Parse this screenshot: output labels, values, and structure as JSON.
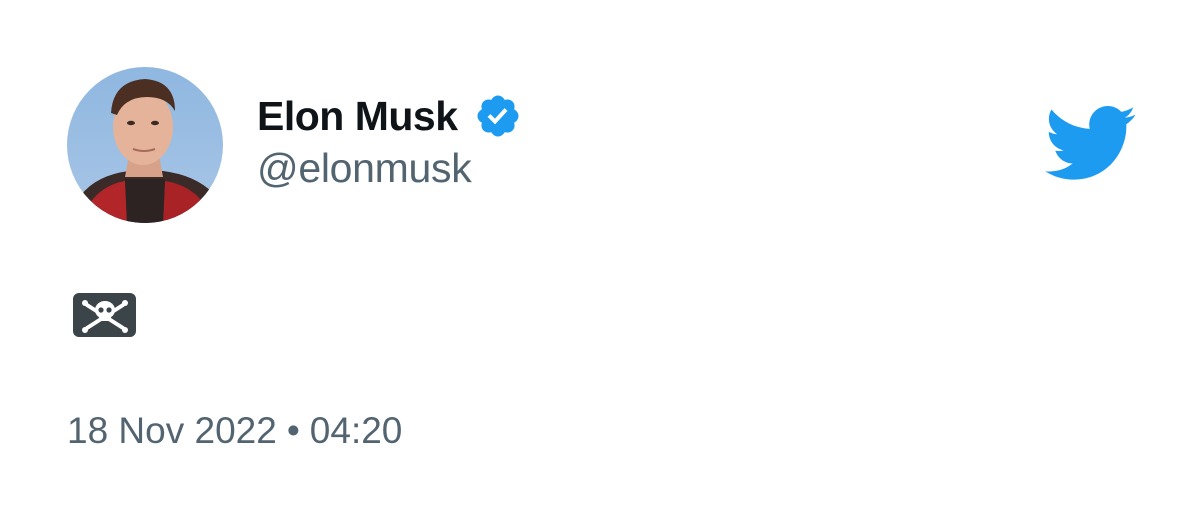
{
  "author": {
    "display_name": "Elon Musk",
    "handle": "@elonmusk",
    "verified": true,
    "avatar_icon": "profile-photo"
  },
  "tweet": {
    "content_emoji": "pirate-flag",
    "date": "18 Nov 2022",
    "separator": "•",
    "time": "04:20"
  },
  "brand": {
    "logo_icon": "twitter-bird-icon",
    "accent_color": "#1d9bf0"
  },
  "colors": {
    "text_primary": "#0f1419",
    "text_secondary": "#536471",
    "background": "#ffffff"
  }
}
